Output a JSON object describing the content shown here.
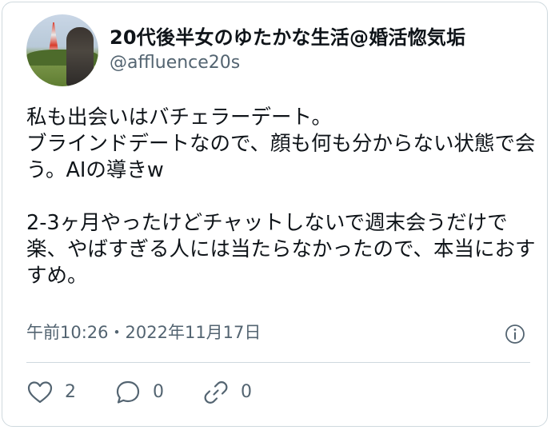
{
  "user": {
    "display_name": "20代後半女のゆたかな生活@婚活惚気垢",
    "handle": "@affluence20s"
  },
  "tweet": {
    "text": "私も出会いはバチェラーデート。\nブラインドデートなので、顔も何も分からない状態で会う。AIの導きw\n\n2-3ヶ月やったけどチャットしないで週末会うだけで楽、やばすぎる人には当たらなかったので、本当におすすめ。",
    "timestamp": "午前10:26・2022年11月17日"
  },
  "actions": {
    "likes": "2",
    "replies": "0",
    "shares": "0"
  },
  "icons": {
    "info": "info-icon",
    "like": "heart-icon",
    "reply": "speech-bubble-icon",
    "share": "link-icon"
  },
  "colors": {
    "text": "#0f1419",
    "secondary": "#536471",
    "border": "#cfd9de"
  }
}
